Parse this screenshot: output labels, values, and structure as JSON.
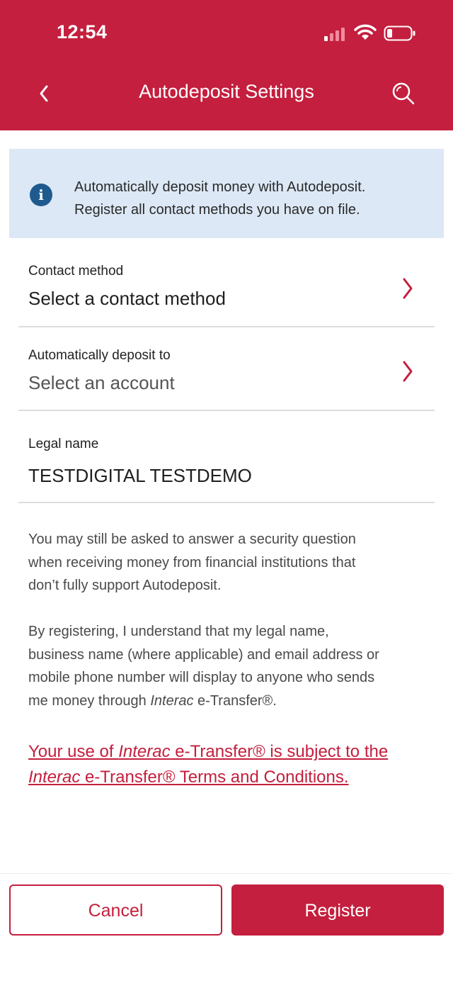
{
  "status_bar": {
    "time": "12:54",
    "icons": [
      "cellular-signal-icon",
      "wifi-icon",
      "battery-icon"
    ]
  },
  "nav": {
    "title": "Autodeposit Settings",
    "back_icon": "chevron-left-icon",
    "search_icon": "search-icon"
  },
  "info_banner": {
    "icon": "info-icon",
    "icon_glyph": "i",
    "line1": "Automatically deposit money with Autodeposit.",
    "line2": "Register all contact methods you have on file."
  },
  "fields": {
    "contact_method": {
      "label": "Contact method",
      "value": "Select a contact method"
    },
    "deposit_to": {
      "label": "Automatically deposit to",
      "value": "Select an account"
    },
    "legal_name": {
      "label": "Legal name",
      "value": "TESTDIGITAL TESTDEMO"
    }
  },
  "disclaimers": {
    "security_line1": "You may still be asked to answer a security question",
    "security_line2": "when receiving money from financial institutions that",
    "security_line3": "don’t fully support Autodeposit.",
    "register_line1": "By registering, I understand that my legal name,",
    "register_line2": "business name (where applicable) and email address or",
    "register_line3": "mobile phone number will display to anyone who sends",
    "register_line4_a": "me money through ",
    "register_line4_b": "Interac",
    "register_line4_c": " e-Transfer®."
  },
  "terms_link": {
    "line1_a": "Your use of ",
    "line1_b": "Interac",
    "line1_c": " e-Transfer® is subject to the",
    "line2_a": "Interac",
    "line2_b": " e-Transfer® Terms and Conditions."
  },
  "buttons": {
    "cancel": "Cancel",
    "register": "Register"
  },
  "colors": {
    "brand_red": "#c41f3e",
    "info_background": "#dce8f5",
    "info_icon": "#1f5a8e"
  }
}
